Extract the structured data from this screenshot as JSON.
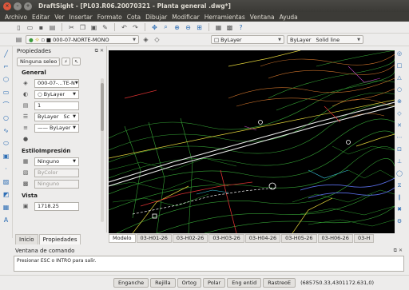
{
  "window": {
    "title": "DraftSight - [PL03.R06.20070321 - Planta general .dwg*]"
  },
  "menu": [
    "Archivo",
    "Editar",
    "Ver",
    "Insertar",
    "Formato",
    "Cota",
    "Dibujar",
    "Modificar",
    "Herramientas",
    "Ventana",
    "Ayuda"
  ],
  "layer_bar": {
    "layer": "000-07-NORTE-MONO",
    "color": "ByLayer",
    "linestyle": "ByLayer",
    "lineweight": "Solid line"
  },
  "properties": {
    "title": "Propiedades",
    "selection": "Ninguna seleo",
    "general_title": "General",
    "general": {
      "layer": "000-07-...TE-N",
      "color": "ByLayer",
      "scale": "1",
      "linestyle": "ByLayer",
      "linestyle_short": "Sc",
      "lineweight": "ByLayer"
    },
    "print_title": "EstiloImpresión",
    "print": {
      "style": "Ninguno",
      "bycolor": "ByColor",
      "table": "Ninguno"
    },
    "view_title": "Vista",
    "view": {
      "value": "1718.25"
    }
  },
  "panel_tabs": [
    "Inicio",
    "Propiedades"
  ],
  "layout_tabs": [
    "Modelo",
    "03-H01-26",
    "03-H02-26",
    "03-H03-26",
    "03-H04-26",
    "03-H05-26",
    "03-H06-26",
    "03-H"
  ],
  "command": {
    "title": "Ventana de comando",
    "text": "Presionar ESC o INTRO para salir."
  },
  "status": {
    "buttons": [
      "Enganche",
      "Rejilla",
      "Ortog",
      "Polar",
      "Eng entid",
      "RastreoE"
    ],
    "coords": "(685750.33,4301172.631,0)"
  },
  "colors": {
    "canvas": "#000000",
    "accent": "#2f6fb5"
  }
}
